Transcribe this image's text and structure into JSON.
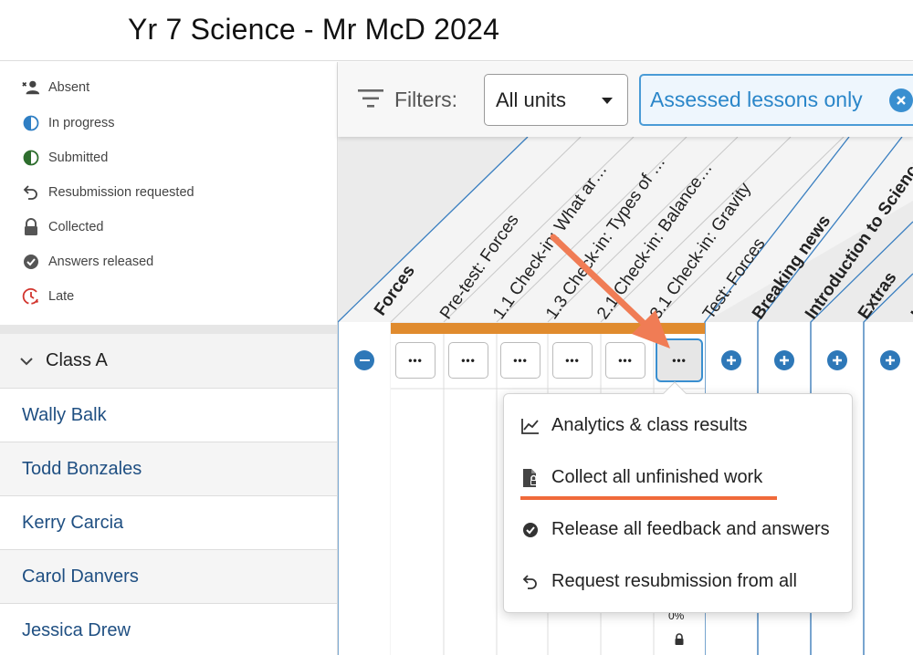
{
  "page": {
    "title": "Yr 7 Science - Mr McD 2024"
  },
  "legend": {
    "items": [
      {
        "label": "Absent",
        "icon": "absent-person-icon"
      },
      {
        "label": "In progress",
        "icon": "half-circle-blue-icon"
      },
      {
        "label": "Submitted",
        "icon": "half-circle-green-icon"
      },
      {
        "label": "Resubmission requested",
        "icon": "undo-arrow-icon"
      },
      {
        "label": "Collected",
        "icon": "lock-icon"
      },
      {
        "label": "Answers released",
        "icon": "check-circle-icon"
      },
      {
        "label": "Late",
        "icon": "clock-late-icon"
      }
    ]
  },
  "class_group": {
    "name": "Class A",
    "icon": "chevron-down-icon"
  },
  "students": [
    "Wally Balk",
    "Todd Bonzales",
    "Kerry Carcia",
    "Carol Danvers",
    "Jessica Drew"
  ],
  "filters": {
    "label": "Filters:",
    "units_value": "All units",
    "assessed_chip": "Assessed lessons only"
  },
  "grid": {
    "unit_forces": "Forces",
    "lessons": [
      "Pre-test: Forces",
      "1.1 Check-in: What ar…",
      "1.3 Check-in: Types of …",
      "2.1 Check-in: Balance…",
      "3.1 Check-in: Gravity",
      "Test: Forces"
    ],
    "other_units": [
      "Breaking news",
      "Introduction to Science",
      "Extras",
      "He"
    ],
    "more_button_label": "•••",
    "cell_percent": "0%",
    "colors": {
      "unit_accent": "#e08b2e",
      "border_blue": "#3a7fc0",
      "add_blue": "#2e78b8"
    }
  },
  "menu": {
    "items": [
      {
        "label": "Analytics & class results",
        "icon": "line-chart-icon"
      },
      {
        "label": "Collect all unfinished work",
        "icon": "file-lock-icon"
      },
      {
        "label": "Release all feedback and answers",
        "icon": "check-circle-icon"
      },
      {
        "label": "Request resubmission from all",
        "icon": "undo-arrow-icon"
      }
    ],
    "highlight_color": "#f06a3a"
  }
}
